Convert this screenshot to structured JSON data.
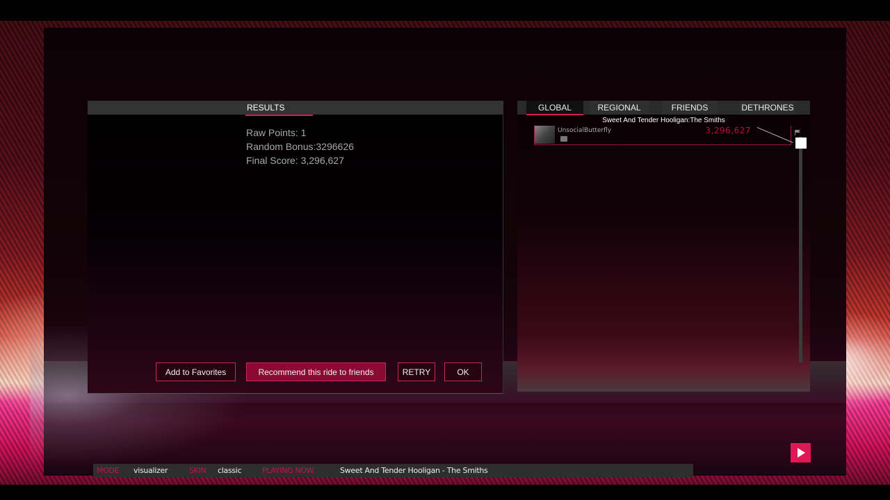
{
  "results_panel": {
    "tab_label": "RESULTS",
    "raw_points": "Raw Points: 1",
    "random_bonus": "Random Bonus:3296626",
    "final_score": "Final Score: 3,296,627",
    "buttons": {
      "add_favorites": "Add to Favorites",
      "recommend": "Recommend this ride to friends",
      "retry": "RETRY",
      "ok": "OK"
    }
  },
  "leaderboard": {
    "tabs": [
      "GLOBAL",
      "REGIONAL",
      "FRIENDS",
      "DETHRONES"
    ],
    "active_tab": "GLOBAL",
    "song_title": "Sweet And Tender Hooligan:The Smiths",
    "entries": [
      {
        "username": "UnsocialButterfly",
        "score": "3,296,627"
      }
    ]
  },
  "status_bar": {
    "mode_label": "MODE",
    "mode_value": "visualizer",
    "skin_label": "SKIN",
    "skin_value": "classic",
    "playing_label": "PLAYING NOW",
    "playing_value": "Sweet And Tender Hooligan - The Smiths"
  },
  "colors": {
    "accent": "#d21c52",
    "button_primary": "#8a0a34",
    "score_red": "#b0143e",
    "play_button": "#e01856"
  }
}
